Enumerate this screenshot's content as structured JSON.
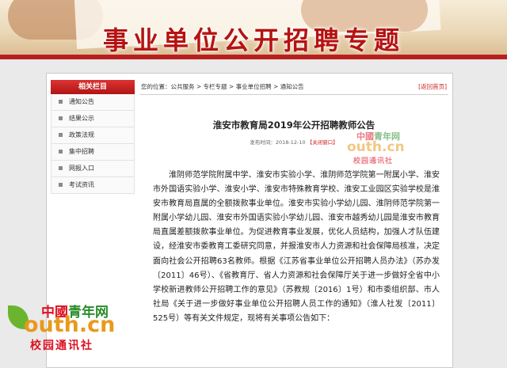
{
  "banner": {
    "title": "事业单位公开招聘专题"
  },
  "sidebar": {
    "header": "相关栏目",
    "items": [
      {
        "label": "通知公告"
      },
      {
        "label": "结果公示"
      },
      {
        "label": "政策法规"
      },
      {
        "label": "集中招聘"
      },
      {
        "label": "网报入口"
      },
      {
        "label": "考试资讯"
      }
    ]
  },
  "breadcrumb": {
    "text": "您的位置：公共服务 > 专栏专题 > 事业单位招聘 > 通知公告",
    "back_label": "[返回首页]"
  },
  "article": {
    "title": "淮安市教育局2019年公开招聘教师公告",
    "meta_prefix": "发布时间：2018-12-10",
    "close_label": "【关闭窗口】",
    "body": "淮阴师范学院附属中学、淮安市实验小学、淮阴师范学院第一附属小学、淮安市外国语实验小学、淮安小学、淮安市特殊教育学校、淮安工业园区实验学校是淮安市教育局直属的全额拨款事业单位。淮安市实验小学幼儿园、淮阴师范学院第一附属小学幼儿园、淮安市外国语实验小学幼儿园、淮安市越秀幼儿园是淮安市教育局直属差额拨款事业单位。为促进教育事业发展，优化人员结构，加强人才队伍建设，经淮安市委教育工委研究同意，并报淮安市人力资源和社会保障局核准，决定面向社会公开招聘63名教师。根据《江苏省事业单位公开招聘人员办法》（苏办发〔2011〕46号）、《省教育厅、省人力资源和社会保障厅关于进一步做好全省中小学校新进教师公开招聘工作的意见》（苏教规〔2016〕1号）和市委组织部、市人社局《关于进一步做好事业单位公开招聘人员工作的通知》（淮人社发〔2011〕525号）等有关文件规定，现将有关事项公告如下："
  },
  "watermark": {
    "line1_a": "中國",
    "line1_b": "青年网",
    "line2": "outh.cn",
    "line3": "校园通讯社"
  },
  "colors": {
    "accent": "#b51212",
    "brand_green": "#2a8c2a",
    "brand_orange": "#e89a1c"
  }
}
